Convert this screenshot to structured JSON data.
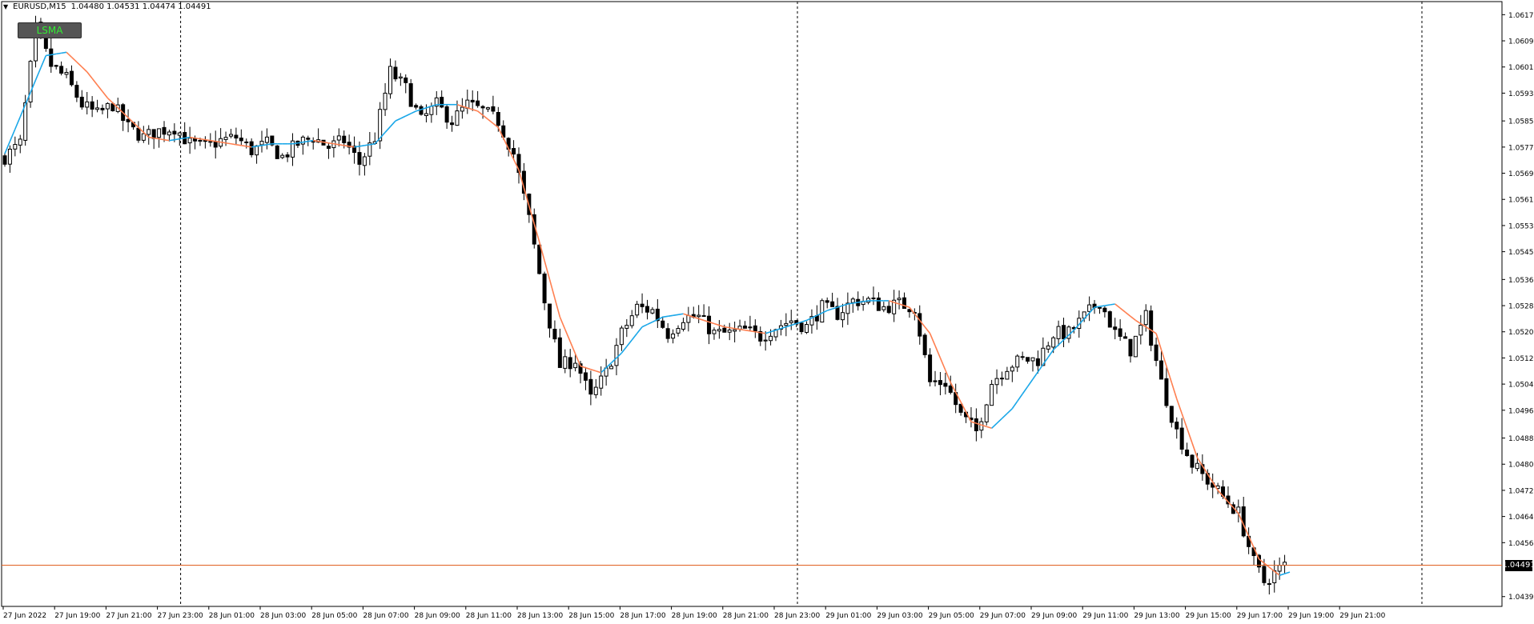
{
  "header": {
    "menu_icon": "triangle-down-icon",
    "symbol": "EURUSD,M15",
    "ohlc": "1.04480 1.04531 1.04474 1.04491"
  },
  "indicator_button": {
    "label": "LSMA",
    "text_color": "#33ee33",
    "bg_color": "#555555"
  },
  "current_price": {
    "label": "1.04491",
    "line_color": "#e06020"
  },
  "colors": {
    "background": "#ffffff",
    "candle": "#000000",
    "ma_up": "#1aa7e8",
    "ma_down": "#ff7f50",
    "grid_separator": "#000000"
  },
  "chart_data": {
    "type": "candlestick",
    "title": "EURUSD,M15",
    "y_ticks": [
      "1.06175",
      "1.06095",
      "1.06015",
      "1.05935",
      "1.05850",
      "1.05770",
      "1.05690",
      "1.05610",
      "1.05530",
      "1.05450",
      "1.05365",
      "1.05285",
      "1.05205",
      "1.05125",
      "1.05045",
      "1.04965",
      "1.04880",
      "1.04800",
      "1.04720",
      "1.04640",
      "1.04560",
      "1.04395"
    ],
    "x_ticks": [
      "27 Jun 2022",
      "27 Jun 19:00",
      "27 Jun 21:00",
      "27 Jun 23:00",
      "28 Jun 01:00",
      "28 Jun 03:00",
      "28 Jun 05:00",
      "28 Jun 07:00",
      "28 Jun 09:00",
      "28 Jun 11:00",
      "28 Jun 13:00",
      "28 Jun 15:00",
      "28 Jun 17:00",
      "28 Jun 19:00",
      "28 Jun 21:00",
      "28 Jun 23:00",
      "29 Jun 01:00",
      "29 Jun 03:00",
      "29 Jun 05:00",
      "29 Jun 07:00",
      "29 Jun 09:00",
      "29 Jun 11:00",
      "29 Jun 13:00",
      "29 Jun 15:00",
      "29 Jun 17:00",
      "29 Jun 19:00",
      "29 Jun 21:00"
    ],
    "ylim": [
      1.04365,
      1.06215
    ],
    "day_separators": [
      "27 Jun 23:00",
      "28 Jun 23:00",
      "29 Jun 23:00"
    ],
    "current_price": 1.04491,
    "close_path": [
      [
        0,
        1.0574
      ],
      [
        3,
        1.0578
      ],
      [
        6,
        1.0613
      ],
      [
        9,
        1.0602
      ],
      [
        12,
        1.0598
      ],
      [
        15,
        1.059
      ],
      [
        18,
        1.0587
      ],
      [
        21,
        1.059
      ],
      [
        24,
        1.0583
      ],
      [
        27,
        1.058
      ],
      [
        30,
        1.0582
      ],
      [
        33,
        1.0583
      ],
      [
        36,
        1.0578
      ],
      [
        39,
        1.0577
      ],
      [
        42,
        1.0579
      ],
      [
        45,
        1.058
      ],
      [
        48,
        1.0576
      ],
      [
        51,
        1.0578
      ],
      [
        54,
        1.0574
      ],
      [
        57,
        1.0578
      ],
      [
        60,
        1.058
      ],
      [
        63,
        1.0577
      ],
      [
        66,
        1.0579
      ],
      [
        69,
        1.0572
      ],
      [
        72,
        1.058
      ],
      [
        75,
        1.06
      ],
      [
        78,
        1.0595
      ],
      [
        81,
        1.0585
      ],
      [
        84,
        1.059
      ],
      [
        87,
        1.0585
      ],
      [
        90,
        1.059
      ],
      [
        93,
        1.0588
      ],
      [
        96,
        1.0585
      ],
      [
        99,
        1.0575
      ],
      [
        102,
        1.0555
      ],
      [
        105,
        1.053
      ],
      [
        108,
        1.051
      ],
      [
        111,
        1.0512
      ],
      [
        114,
        1.05
      ],
      [
        117,
        1.0508
      ],
      [
        120,
        1.052
      ],
      [
        123,
        1.0528
      ],
      [
        126,
        1.0527
      ],
      [
        129,
        1.052
      ],
      [
        132,
        1.0525
      ],
      [
        135,
        1.0525
      ],
      [
        138,
        1.052
      ],
      [
        141,
        1.052
      ],
      [
        144,
        1.0521
      ],
      [
        147,
        1.0519
      ],
      [
        150,
        1.0522
      ],
      [
        153,
        1.0524
      ],
      [
        156,
        1.0522
      ],
      [
        159,
        1.0528
      ],
      [
        162,
        1.0526
      ],
      [
        165,
        1.053
      ],
      [
        168,
        1.053
      ],
      [
        171,
        1.0528
      ],
      [
        174,
        1.0529
      ],
      [
        177,
        1.0528
      ],
      [
        180,
        1.0505
      ],
      [
        183,
        1.0505
      ],
      [
        186,
        1.0495
      ],
      [
        189,
        1.049
      ],
      [
        192,
        1.0505
      ],
      [
        195,
        1.051
      ],
      [
        198,
        1.0512
      ],
      [
        201,
        1.0512
      ],
      [
        204,
        1.052
      ],
      [
        207,
        1.052
      ],
      [
        210,
        1.0525
      ],
      [
        213,
        1.053
      ],
      [
        216,
        1.052
      ],
      [
        219,
        1.0515
      ],
      [
        222,
        1.0525
      ],
      [
        225,
        1.0505
      ],
      [
        228,
        1.049
      ],
      [
        231,
        1.048
      ],
      [
        234,
        1.0475
      ],
      [
        237,
        1.047
      ],
      [
        240,
        1.0465
      ],
      [
        243,
        1.045
      ],
      [
        245,
        1.0444
      ],
      [
        248,
        1.0448
      ],
      [
        249,
        1.0449
      ]
    ],
    "lsma_path": [
      [
        0,
        1.0575
      ],
      [
        4,
        1.059
      ],
      [
        8,
        1.0605
      ],
      [
        12,
        1.0606
      ],
      [
        16,
        1.06
      ],
      [
        20,
        1.0592
      ],
      [
        24,
        1.0586
      ],
      [
        28,
        1.058
      ],
      [
        32,
        1.0579
      ],
      [
        36,
        1.058
      ],
      [
        40,
        1.0579
      ],
      [
        44,
        1.0578
      ],
      [
        48,
        1.0577
      ],
      [
        52,
        1.0578
      ],
      [
        56,
        1.0578
      ],
      [
        60,
        1.0579
      ],
      [
        64,
        1.0578
      ],
      [
        68,
        1.0577
      ],
      [
        72,
        1.0578
      ],
      [
        76,
        1.0585
      ],
      [
        80,
        1.0588
      ],
      [
        84,
        1.059
      ],
      [
        88,
        1.059
      ],
      [
        92,
        1.0588
      ],
      [
        96,
        1.0583
      ],
      [
        100,
        1.057
      ],
      [
        104,
        1.0548
      ],
      [
        108,
        1.0525
      ],
      [
        112,
        1.051
      ],
      [
        116,
        1.0508
      ],
      [
        120,
        1.0514
      ],
      [
        124,
        1.0522
      ],
      [
        128,
        1.0525
      ],
      [
        132,
        1.0526
      ],
      [
        136,
        1.0524
      ],
      [
        140,
        1.0522
      ],
      [
        144,
        1.0521
      ],
      [
        148,
        1.052
      ],
      [
        152,
        1.0522
      ],
      [
        156,
        1.0524
      ],
      [
        160,
        1.0527
      ],
      [
        164,
        1.0529
      ],
      [
        168,
        1.053
      ],
      [
        172,
        1.053
      ],
      [
        176,
        1.0528
      ],
      [
        180,
        1.052
      ],
      [
        184,
        1.0505
      ],
      [
        188,
        1.0493
      ],
      [
        192,
        1.0491
      ],
      [
        196,
        1.0497
      ],
      [
        200,
        1.0506
      ],
      [
        204,
        1.0515
      ],
      [
        208,
        1.0521
      ],
      [
        212,
        1.0528
      ],
      [
        216,
        1.0529
      ],
      [
        220,
        1.0524
      ],
      [
        224,
        1.052
      ],
      [
        228,
        1.05
      ],
      [
        232,
        1.0482
      ],
      [
        236,
        1.0472
      ],
      [
        240,
        1.0465
      ],
      [
        244,
        1.0451
      ],
      [
        248,
        1.0446
      ],
      [
        250,
        1.0447
      ]
    ],
    "bars_total": 250
  }
}
